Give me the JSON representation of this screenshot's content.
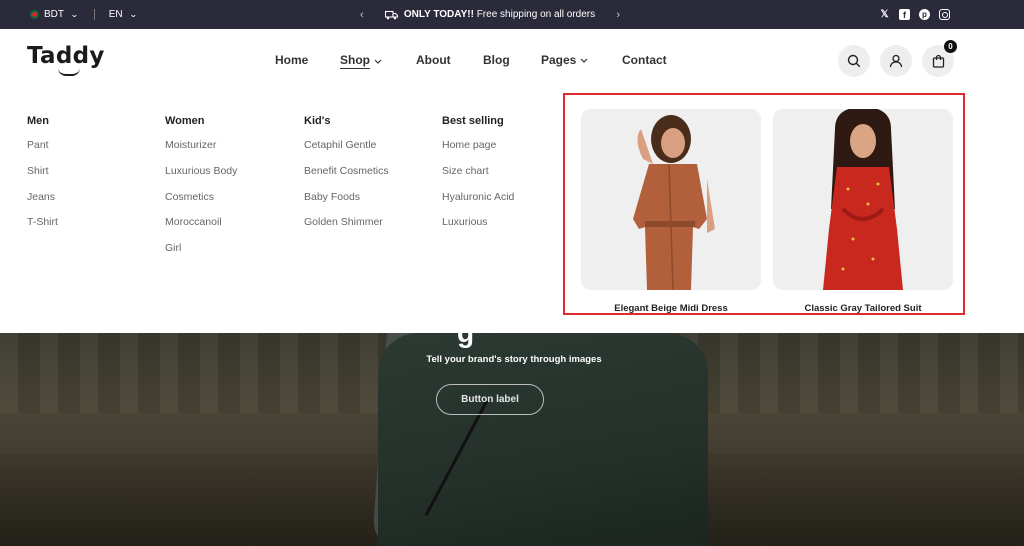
{
  "topbar": {
    "currency": "BDT",
    "language": "EN",
    "promo_bold": "ONLY TODAY!!",
    "promo_text": "Free shipping on all orders"
  },
  "header": {
    "logo": "Taddy",
    "nav": [
      "Home",
      "Shop",
      "About",
      "Blog",
      "Pages",
      "Contact"
    ],
    "cart_count": "0"
  },
  "mega_menu": {
    "columns": [
      {
        "title": "Men",
        "links": [
          "Pant",
          "Shirt",
          "Jeans",
          "T-Shirt"
        ]
      },
      {
        "title": "Women",
        "links": [
          "Moisturizer",
          "Luxurious Body",
          "Cosmetics",
          "Moroccanoil",
          "Girl"
        ]
      },
      {
        "title": "Kid's",
        "links": [
          "Cetaphil Gentle",
          "Benefit Cosmetics",
          "Baby Foods",
          "Golden Shimmer"
        ]
      },
      {
        "title": "Best selling",
        "links": [
          "Home page",
          "Size chart",
          "Hyaluronic Acid",
          "Luxurious"
        ]
      }
    ],
    "products": [
      {
        "title": "Elegant Beige Midi Dress",
        "dress_color": "#b2603c"
      },
      {
        "title": "Classic Gray Tailored Suit",
        "dress_color": "#c8281e"
      }
    ],
    "highlight_color": "#e3282d"
  },
  "hero": {
    "heading_fragment": "g",
    "subtitle": "Tell your brand's story through images",
    "button_label": "Button label"
  }
}
